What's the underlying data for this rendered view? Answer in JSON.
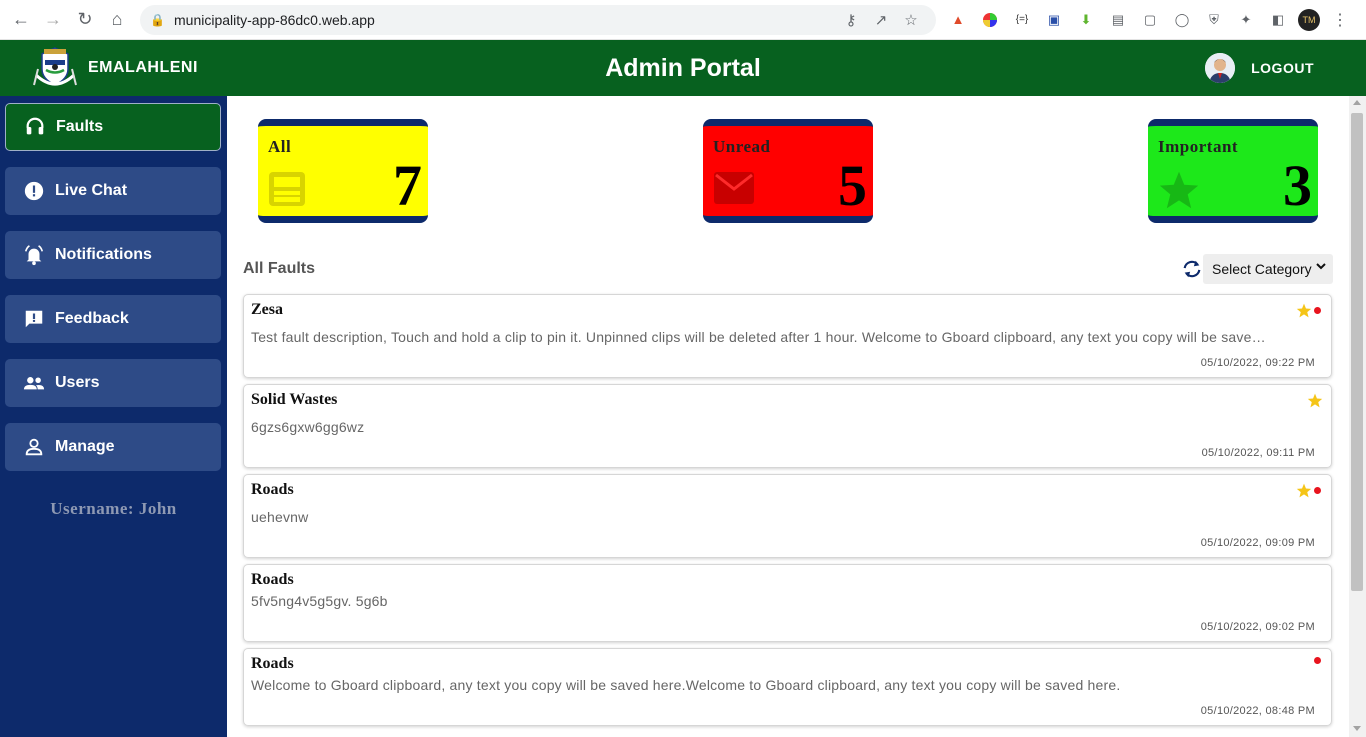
{
  "browser": {
    "url": "municipality-app-86dc0.web.app",
    "profile_initials": "TM"
  },
  "header": {
    "brand": "EMALAHLENI",
    "title": "Admin Portal",
    "logout": "LOGOUT"
  },
  "sidebar": {
    "items": [
      {
        "label": "Faults",
        "icon": "headset-icon"
      },
      {
        "label": "Live Chat",
        "icon": "alert-circle-icon"
      },
      {
        "label": "Notifications",
        "icon": "bell-ring-icon"
      },
      {
        "label": "Feedback",
        "icon": "feedback-icon"
      },
      {
        "label": "Users",
        "icon": "users-icon"
      },
      {
        "label": "Manage",
        "icon": "person-icon"
      }
    ],
    "username": "Username: John"
  },
  "cards": [
    {
      "label": "All",
      "count": "7",
      "color": "#ffff00",
      "icon": "inbox-icon"
    },
    {
      "label": "Unread",
      "count": "5",
      "color": "#ff0000",
      "icon": "mail-icon"
    },
    {
      "label": "Important",
      "count": "3",
      "color": "#1de81a",
      "icon": "star-icon"
    }
  ],
  "section": {
    "title": "All Faults",
    "select_value": "Select Category"
  },
  "faults": [
    {
      "title": "Zesa",
      "description": "Test fault description, Touch and hold a clip to pin it. Unpinned clips will be deleted after 1 hour. Welcome to Gboard clipboard, any text you copy will be saved here.",
      "date": "05/10/2022, 09:22 PM",
      "important": true,
      "unread": true
    },
    {
      "title": "Solid Wastes",
      "description": "6gzs6gxw6gg6wz",
      "date": "05/10/2022, 09:11 PM",
      "important": true,
      "unread": false
    },
    {
      "title": "Roads",
      "description": "uehevnw",
      "date": "05/10/2022, 09:09 PM",
      "important": true,
      "unread": true
    },
    {
      "title": "Roads",
      "description": "5fv5ng4v5g5gv. 5g6b",
      "date": "05/10/2022, 09:02 PM",
      "important": false,
      "unread": false
    },
    {
      "title": "Roads",
      "description": "Welcome to Gboard clipboard, any text you copy will be saved here.Welcome to Gboard clipboard, any text you copy will be saved here.",
      "date": "05/10/2022, 08:48 PM",
      "important": false,
      "unread": true
    }
  ],
  "colors": {
    "header_green": "#07611f",
    "sidebar_navy": "#0d2a6b",
    "sidebar_item": "#2e4b87",
    "star": "#f5c518",
    "unread_dot": "#e8141e"
  }
}
